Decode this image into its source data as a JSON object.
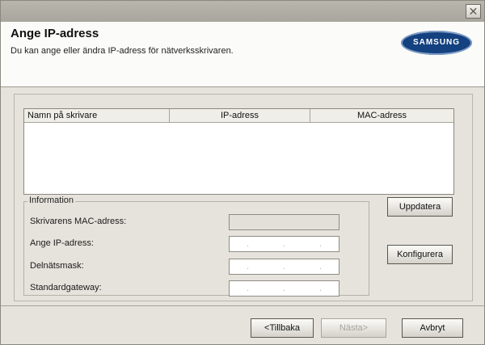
{
  "header": {
    "title": "Ange IP-adress",
    "subtitle": "Du kan ange eller ändra IP-adress för nätverksskrivaren.",
    "logo_text": "SAMSUNG",
    "close_glyph": "✕"
  },
  "list": {
    "columns": [
      "Namn på skrivare",
      "IP-adress",
      "MAC-adress"
    ]
  },
  "info": {
    "legend": "Information",
    "mac_label": "Skrivarens MAC-adress:",
    "ip_label": "Ange IP-adress:",
    "subnet_label": "Delnätsmask:",
    "gateway_label": "Standardgateway:",
    "separator": "."
  },
  "buttons": {
    "update": "Uppdatera",
    "configure": "Konfigurera",
    "back": "<Tillbaka",
    "next": "Nästa>",
    "cancel": "Avbryt"
  },
  "colors": {
    "logo_bg": "#14417f",
    "header_bg": "#fbfbf9",
    "dialog_bg": "#e6e3dc"
  }
}
